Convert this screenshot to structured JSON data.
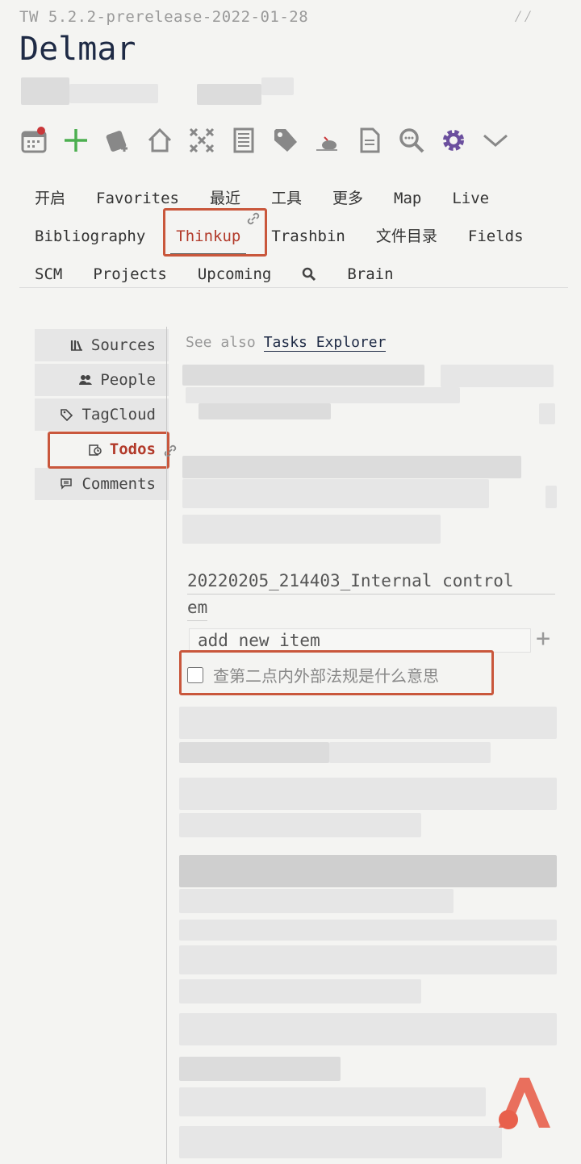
{
  "header": {
    "version": "TW 5.2.2-prerelease-2022-01-28",
    "title": "Delmar"
  },
  "toolbar": {
    "icons": [
      "calendar-icon",
      "plus-icon",
      "journal-icon",
      "home-icon",
      "grid-icon",
      "notebook-icon",
      "tag-icon",
      "mouse-icon",
      "document-icon",
      "search-icon",
      "gear-icon",
      "chevron-down-icon"
    ]
  },
  "tabs": {
    "row1": [
      "开启",
      "Favorites",
      "最近",
      "工具",
      "更多",
      "Map",
      "Live"
    ],
    "row2": [
      "Bibliography",
      "Thinkup",
      "Trashbin",
      "文件目录",
      "Fields"
    ],
    "row3": [
      "SCM",
      "Projects",
      "Upcoming",
      "Brain"
    ],
    "active": "Thinkup"
  },
  "sidebar": {
    "items": [
      {
        "label": "Sources",
        "icon": "books-icon"
      },
      {
        "label": "People",
        "icon": "people-icon"
      },
      {
        "label": "TagCloud",
        "icon": "tag-icon"
      },
      {
        "label": "Todos",
        "icon": "clock-list-icon"
      },
      {
        "label": "Comments",
        "icon": "comments-icon"
      }
    ],
    "active": "Todos"
  },
  "main": {
    "see_also_prefix": "See also",
    "see_also_link": "Tasks Explorer",
    "todo_list_title_line1": "20220205_214403_Internal control",
    "todo_list_title_line2": "em",
    "new_item_placeholder": "add new item",
    "add_symbol": "+",
    "todo_item": "查第二点内外部法规是什么意思"
  },
  "colors": {
    "accent": "#b23a2a",
    "highlight": "#c9573c",
    "title": "#1e2a45",
    "plus_green": "#4caf50",
    "gear_purple": "#6b4f9e"
  }
}
